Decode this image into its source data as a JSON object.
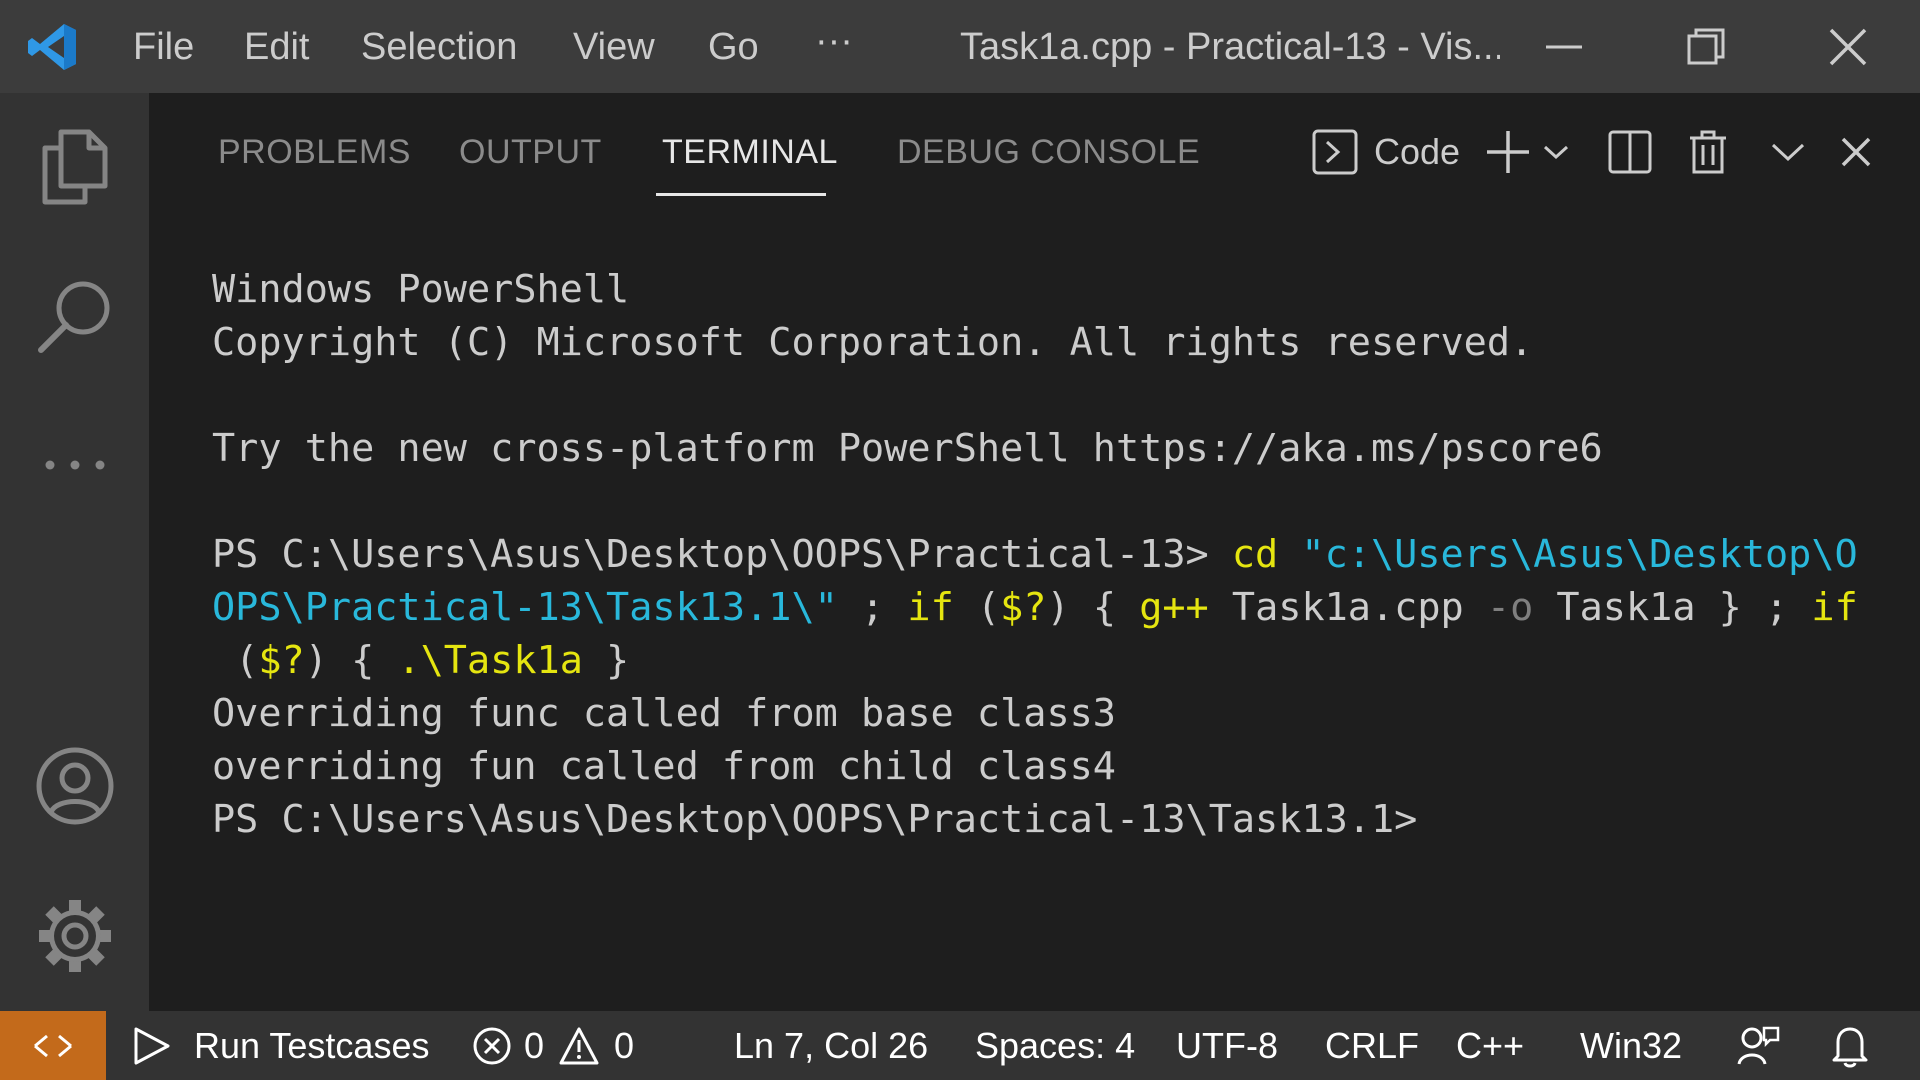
{
  "titlebar": {
    "menu": [
      "File",
      "Edit",
      "Selection",
      "View",
      "Go"
    ],
    "more": "···",
    "window_title": "Task1a.cpp - Practical-13 - Vis..."
  },
  "panel": {
    "tabs": [
      "PROBLEMS",
      "OUTPUT",
      "TERMINAL",
      "DEBUG CONSOLE"
    ],
    "active_tab": "TERMINAL",
    "shell_label": "Code"
  },
  "terminal": {
    "lines": [
      [
        {
          "t": "Windows PowerShell",
          "c": ""
        }
      ],
      [
        {
          "t": "Copyright (C) Microsoft Corporation. All rights reserved.",
          "c": ""
        }
      ],
      [
        {
          "t": "",
          "c": ""
        }
      ],
      [
        {
          "t": "Try the new cross-platform PowerShell https://aka.ms/pscore6",
          "c": ""
        }
      ],
      [
        {
          "t": "",
          "c": ""
        }
      ],
      [
        {
          "t": "PS C:\\Users\\Asus\\Desktop\\OOPS\\Practical-13> ",
          "c": ""
        },
        {
          "t": "cd",
          "c": "yellow"
        },
        {
          "t": " \"c:\\Users\\Asus\\Desktop\\O",
          "c": "cyan"
        }
      ],
      [
        {
          "t": "OPS\\Practical-13\\Task13.1\\\"",
          "c": "cyan"
        },
        {
          "t": " ; ",
          "c": ""
        },
        {
          "t": "if",
          "c": "yellow"
        },
        {
          "t": " (",
          "c": ""
        },
        {
          "t": "$?",
          "c": "yellow"
        },
        {
          "t": ") { ",
          "c": ""
        },
        {
          "t": "g++",
          "c": "yellow"
        },
        {
          "t": " Task1a.cpp ",
          "c": ""
        },
        {
          "t": "-o",
          "c": "dim"
        },
        {
          "t": " Task1a } ; ",
          "c": ""
        },
        {
          "t": "if",
          "c": "yellow"
        }
      ],
      [
        {
          "t": " (",
          "c": ""
        },
        {
          "t": "$?",
          "c": "yellow"
        },
        {
          "t": ") { ",
          "c": ""
        },
        {
          "t": ".\\Task1a",
          "c": "yellow"
        },
        {
          "t": " }",
          "c": ""
        }
      ],
      [
        {
          "t": "Overriding func called from base class3",
          "c": ""
        }
      ],
      [
        {
          "t": "overriding fun called from child class4",
          "c": ""
        }
      ],
      [
        {
          "t": "PS C:\\Users\\Asus\\Desktop\\OOPS\\Practical-13\\Task13.1>",
          "c": ""
        }
      ]
    ]
  },
  "statusbar": {
    "run_testcases": "Run Testcases",
    "errors": "0",
    "warnings": "0",
    "position": "Ln 7, Col 26",
    "spaces": "Spaces: 4",
    "encoding": "UTF-8",
    "eol": "CRLF",
    "language": "C++",
    "platform": "Win32"
  },
  "icons": {
    "logo": "vscode-logo-icon",
    "explorer": "files-icon",
    "search": "search-icon",
    "more": "ellipsis-icon",
    "accounts": "account-icon",
    "settings": "gear-icon",
    "terminal": "terminal-icon",
    "add": "plus-icon",
    "split": "split-icon",
    "trash": "trash-icon",
    "remote": "remote-icon",
    "feedback": "feedback-icon",
    "bell": "bell-icon"
  },
  "colors": {
    "remote_bg": "#c36a1b",
    "terminal_yellow": "#e5e510",
    "terminal_cyan": "#29b8db"
  }
}
